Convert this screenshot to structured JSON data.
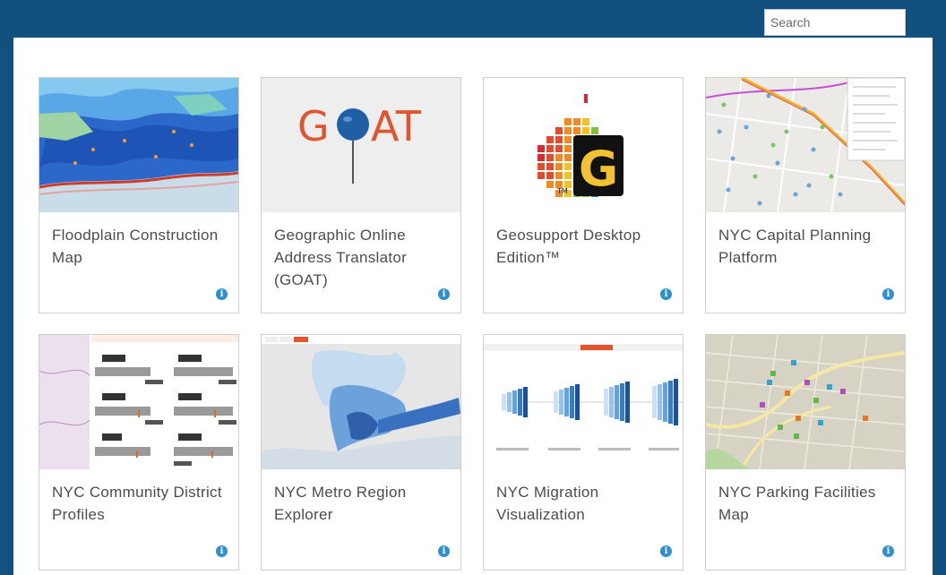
{
  "search": {
    "placeholder": "Search"
  },
  "cards": [
    {
      "title": "Floodplain Construction Map",
      "thumb": "flood-map-thumbnail"
    },
    {
      "title": "Geographic Online Address Translator (GOAT)",
      "thumb": "goat-logo-thumbnail",
      "logo_text": {
        "left": "G",
        "right": "AT"
      }
    },
    {
      "title": "Geosupport Desktop Edition™",
      "thumb": "geosupport-logo-thumbnail",
      "logo_text": {
        "letter": "G",
        "tm": "TM"
      }
    },
    {
      "title": "NYC Capital Planning Platform",
      "thumb": "capital-planning-map-thumbnail"
    },
    {
      "title": "NYC Community District Profiles",
      "thumb": "community-profiles-thumbnail"
    },
    {
      "title": "NYC Metro Region Explorer",
      "thumb": "metro-region-map-thumbnail"
    },
    {
      "title": "NYC Migration Visualization",
      "thumb": "migration-chart-thumbnail"
    },
    {
      "title": "NYC Parking Facilities Map",
      "thumb": "parking-map-thumbnail"
    }
  ],
  "info_icon": "i",
  "colors": {
    "header": "#11507f",
    "info": "#2f8fd0",
    "goat_orange": "#e0552e",
    "goat_blue": "#1f5fa6"
  }
}
